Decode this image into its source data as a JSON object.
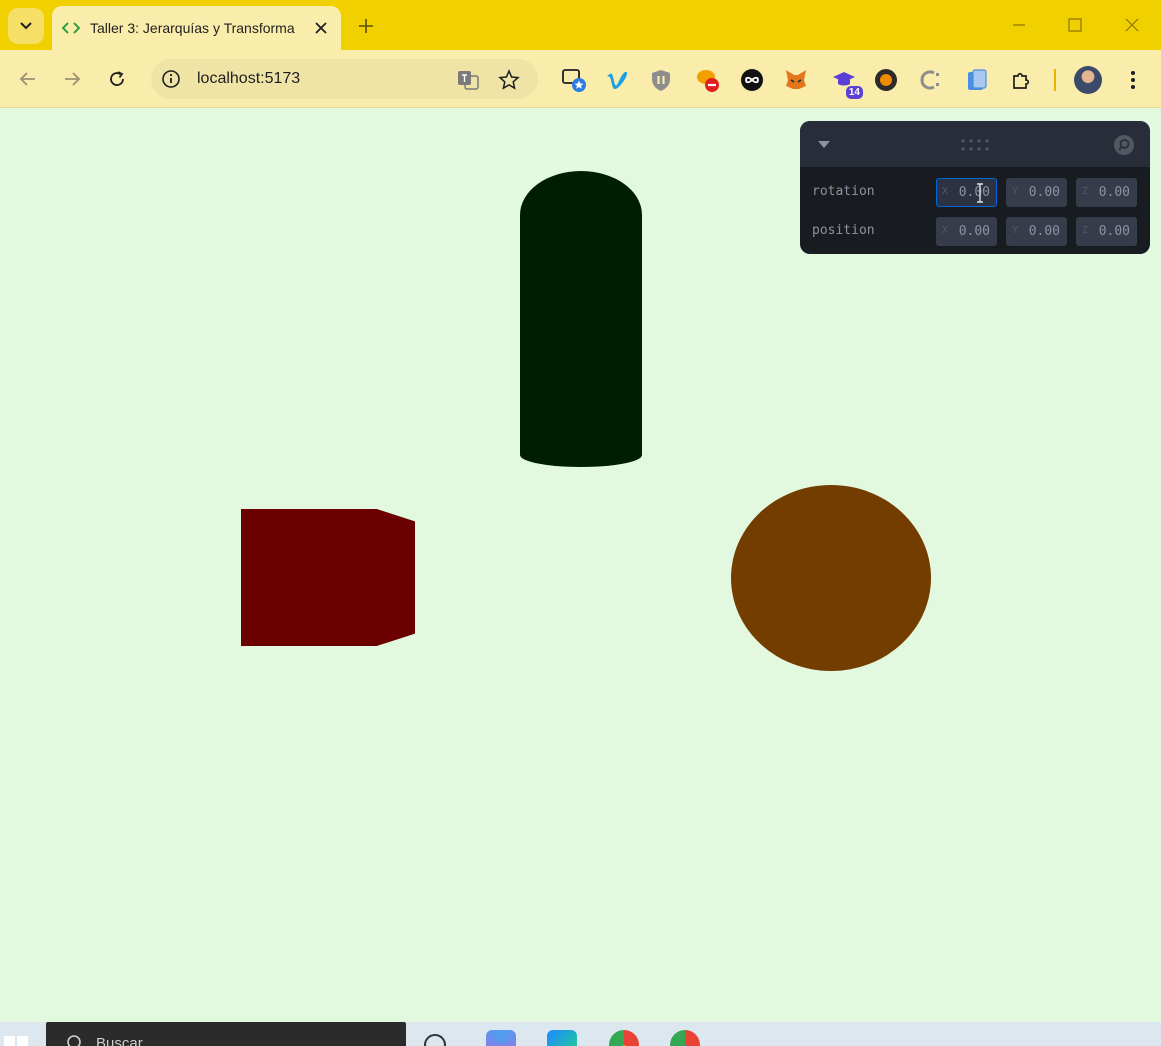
{
  "browser": {
    "tab": {
      "title": "Taller 3: Jerarquías y Transforma"
    },
    "address": {
      "url": "localhost:5173"
    },
    "extensions": {
      "badge_count": "14"
    },
    "theme": {
      "tab_strip": "#f1d000",
      "toolbar": "#faedab"
    }
  },
  "scene": {
    "background": "#e2f9e0",
    "objects": [
      {
        "type": "cylinder",
        "color": "#001f00"
      },
      {
        "type": "box",
        "color": "#6b0000"
      },
      {
        "type": "sphere",
        "color": "#743d00"
      }
    ]
  },
  "panel": {
    "rows": [
      {
        "label": "rotation",
        "x_axis": "X",
        "x": "0.00",
        "y_axis": "Y",
        "y": "0.00",
        "z_axis": "Z",
        "z": "0.00"
      },
      {
        "label": "position",
        "x_axis": "X",
        "x": "0.00",
        "y_axis": "Y",
        "y": "0.00",
        "z_axis": "Z",
        "z": "0.00"
      }
    ]
  },
  "taskbar": {
    "search_placeholder": "Buscar"
  }
}
